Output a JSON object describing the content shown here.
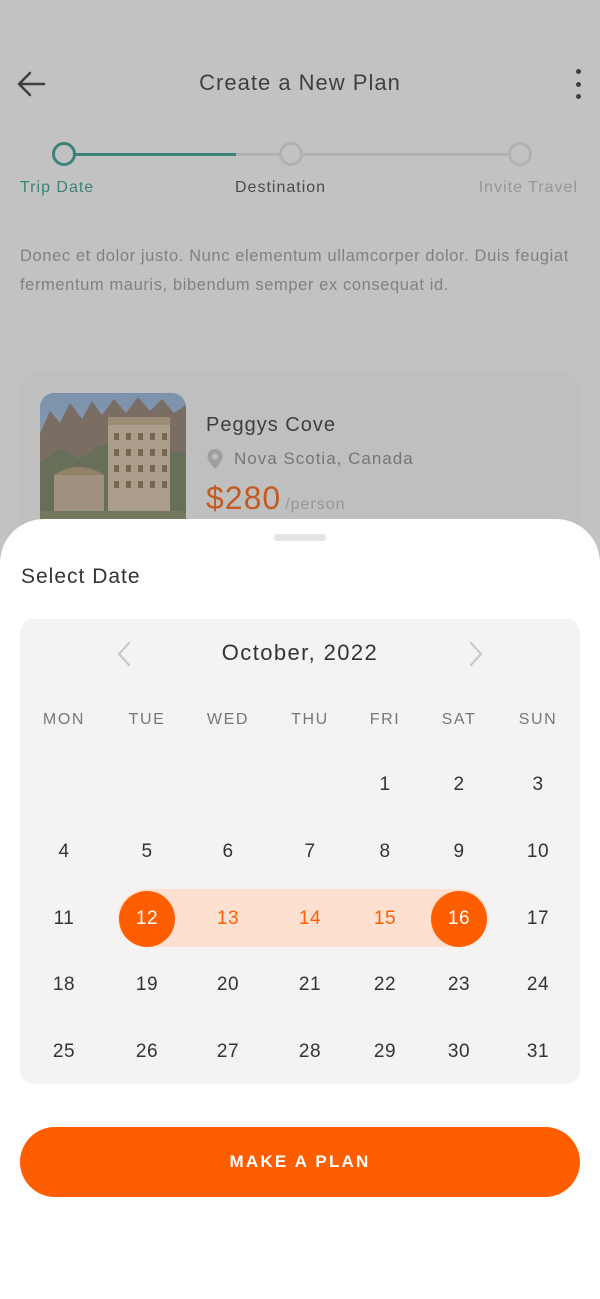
{
  "header": {
    "title": "Create a New Plan",
    "back_icon": "arrow-left-icon",
    "menu_icon": "kebab-menu-icon"
  },
  "stepper": {
    "steps": [
      {
        "label": "Trip Date",
        "state": "active"
      },
      {
        "label": "Destination",
        "state": "pending"
      },
      {
        "label": "Invite Travel",
        "state": "pending"
      }
    ]
  },
  "intro_text": "Donec et dolor justo. Nunc elementum ullamcorper dolor. Duis feugiat fermentum mauris, bibendum semper ex consequat id.",
  "trip_card": {
    "name": "Peggys Cove",
    "location": "Nova Scotia, Canada",
    "location_icon": "map-pin-icon",
    "price": "$280",
    "price_unit": "/person"
  },
  "date_sheet": {
    "title": "Select Date",
    "month_label": "October, 2022",
    "prev_icon": "chevron-left-icon",
    "next_icon": "chevron-right-icon",
    "weekdays": [
      "MON",
      "TUE",
      "WED",
      "THU",
      "FRI",
      "SAT",
      "SUN"
    ],
    "weeks": [
      [
        "",
        "",
        "",
        "",
        "1",
        "2",
        "3"
      ],
      [
        "4",
        "5",
        "6",
        "7",
        "8",
        "9",
        "10"
      ],
      [
        "11",
        "12",
        "13",
        "14",
        "15",
        "16",
        "17"
      ],
      [
        "18",
        "19",
        "20",
        "21",
        "22",
        "23",
        "24"
      ],
      [
        "25",
        "26",
        "27",
        "28",
        "29",
        "30",
        "31"
      ]
    ],
    "range_start": "12",
    "range_end": "16"
  },
  "cta_label": "MAKE A PLAN",
  "colors": {
    "accent": "#ff5e00",
    "range_fill": "#fde0d0",
    "teal": "#2a9d8f",
    "calendar_bg": "#f5f3f2"
  }
}
